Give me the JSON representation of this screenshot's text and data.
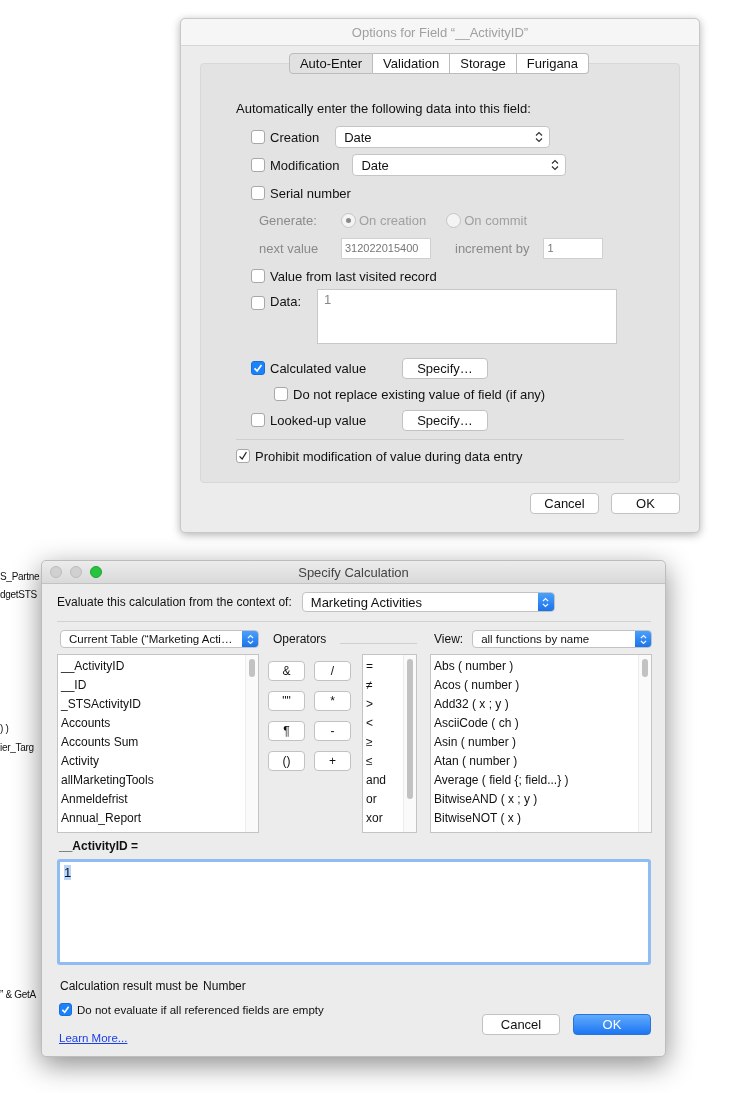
{
  "background_text": [
    "S_Partne",
    "dgetSTS",
    ") )",
    "ier_Targ",
    "” & GetA"
  ],
  "field_options": {
    "title": "Options for Field “__ActivityID”",
    "tabs": [
      {
        "label": "Auto-Enter",
        "selected": true
      },
      {
        "label": "Validation",
        "selected": false
      },
      {
        "label": "Storage",
        "selected": false
      },
      {
        "label": "Furigana",
        "selected": false
      }
    ],
    "heading": "Automatically enter the following data into this field:",
    "creation": {
      "label": "Creation",
      "checked": false,
      "value": "Date"
    },
    "modification": {
      "label": "Modification",
      "checked": false,
      "value": "Date"
    },
    "serial": {
      "label": "Serial number",
      "checked": false,
      "disabled": true,
      "generate_label": "Generate:",
      "options": [
        {
          "label": "On creation",
          "selected": true
        },
        {
          "label": "On commit",
          "selected": false
        }
      ],
      "next_value_label": "next value",
      "next_value": "312022015400",
      "increment_label": "increment by",
      "increment": "1"
    },
    "last_visited": {
      "label": "Value from last visited record",
      "checked": false
    },
    "data": {
      "label": "Data:",
      "checked": false,
      "value": "1"
    },
    "calculated": {
      "label": "Calculated value",
      "checked": true,
      "button": "Specify…"
    },
    "no_replace": {
      "label": "Do not replace existing value of field (if any)",
      "checked": false
    },
    "looked_up": {
      "label": "Looked-up value",
      "checked": false,
      "button": "Specify…"
    },
    "prohibit": {
      "label": "Prohibit modification of value during data entry",
      "checked": true
    },
    "buttons": [
      "Cancel",
      "OK"
    ]
  },
  "calculation": {
    "title": "Specify Calculation",
    "context_label": "Evaluate this calculation from the context of:",
    "context": "Marketing Activities",
    "table_select": "Current Table (“Marketing Acti…",
    "fields": [
      "__ActivityID",
      "__ID",
      "_STSActivityID",
      "Accounts",
      "Accounts Sum",
      "Activity",
      "allMarketingTools",
      "Anmeldefrist",
      "Annual_Report"
    ],
    "operators_label": "Operators",
    "operator_buttons": [
      "&",
      "/",
      "\"\"",
      "*",
      "¶",
      "-",
      "()",
      "+"
    ],
    "operator_list": [
      "=",
      "≠",
      ">",
      "<",
      "≥",
      "≤",
      "and",
      "or",
      "xor"
    ],
    "view_label": "View:",
    "view": "all functions by name",
    "functions": [
      "Abs ( number )",
      "Acos ( number )",
      "Add32 ( x ; y )",
      "AsciiCode ( ch )",
      "Asin ( number )",
      "Atan ( number )",
      "Average ( field {; field...} )",
      "BitwiseAND ( x ; y )",
      "BitwiseNOT ( x )"
    ],
    "formula_label": "__ActivityID =",
    "formula": "1",
    "result_label": "Calculation result must be",
    "result_type": "Number",
    "no_evaluate": {
      "label": "Do not evaluate if all referenced fields are empty",
      "checked": true
    },
    "learn_more": "Learn More...",
    "buttons": [
      "Cancel",
      "OK"
    ]
  }
}
